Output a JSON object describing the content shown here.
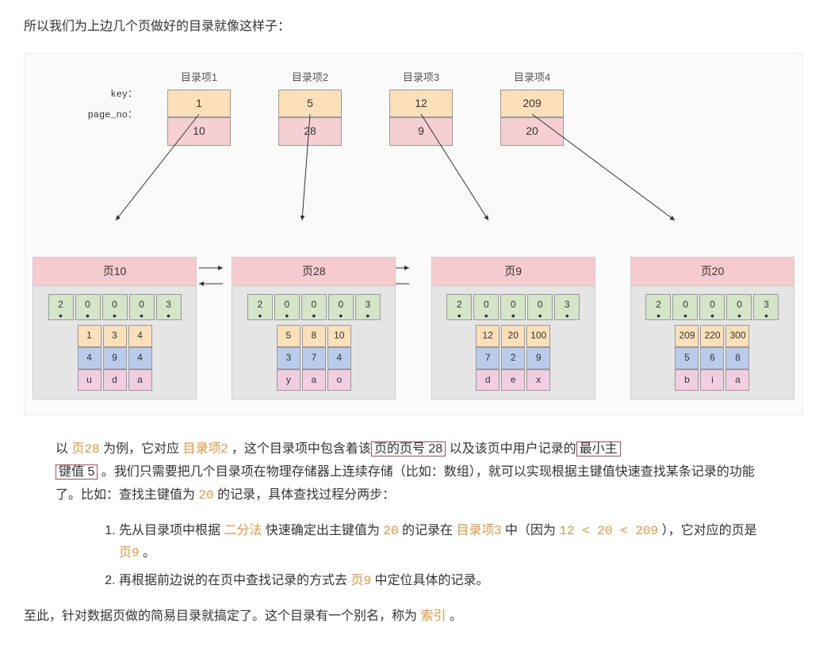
{
  "intro": "所以我们为上边几个页做好的目录就像这样子：",
  "index_labels": {
    "key": "key：",
    "page": "page_no："
  },
  "index_items": [
    {
      "title": "目录项1",
      "key": "1",
      "page": "10"
    },
    {
      "title": "目录项2",
      "key": "5",
      "page": "28"
    },
    {
      "title": "目录项3",
      "key": "12",
      "page": "9"
    },
    {
      "title": "目录项4",
      "key": "209",
      "page": "20"
    }
  ],
  "pages": [
    {
      "title": "页10",
      "slots": [
        "2",
        "0",
        "0",
        "0",
        "3"
      ],
      "recs": [
        {
          "c": [
            "1",
            "4",
            "u"
          ]
        },
        {
          "c": [
            "3",
            "9",
            "d"
          ]
        },
        {
          "c": [
            "4",
            "4",
            "a"
          ]
        }
      ]
    },
    {
      "title": "页28",
      "slots": [
        "2",
        "0",
        "0",
        "0",
        "3"
      ],
      "recs": [
        {
          "c": [
            "5",
            "3",
            "y"
          ]
        },
        {
          "c": [
            "8",
            "7",
            "a"
          ]
        },
        {
          "c": [
            "10",
            "4",
            "o"
          ]
        }
      ]
    },
    {
      "title": "页9",
      "slots": [
        "2",
        "0",
        "0",
        "0",
        "3"
      ],
      "recs": [
        {
          "c": [
            "12",
            "7",
            "d"
          ]
        },
        {
          "c": [
            "20",
            "2",
            "e"
          ]
        },
        {
          "c": [
            "100",
            "9",
            "x"
          ]
        }
      ]
    },
    {
      "title": "页20",
      "slots": [
        "2",
        "0",
        "0",
        "0",
        "3"
      ],
      "recs": [
        {
          "c": [
            "209",
            "5",
            "b"
          ]
        },
        {
          "c": [
            "220",
            "6",
            "i"
          ]
        },
        {
          "c": [
            "300",
            "8",
            "a"
          ]
        }
      ]
    }
  ],
  "para1": {
    "t1": "以 ",
    "page28": "页28",
    "t2": " 为例，它对应 ",
    "idx2": "目录项2",
    "t3": " ，这个目录项中包含着该",
    "box1": "页的页号 28",
    "t4": " 以及该页中用户记录的",
    "box2a": "最小主",
    "box2b": "键值 5",
    "t5": " 。我们只需要把几个目录项在物理存储器上连续存储（比如：数组），就可以实现根据主键值快速查找某条记录的功能了。比如：查找主键值为 ",
    "v20": "20",
    "t6": " 的记录，具体查找过程分两步："
  },
  "step1": {
    "t1": "先从目录项中根据 ",
    "bin": "二分法",
    "t2": " 快速确定出主键值为 ",
    "v20": "20",
    "t3": " 的记录在 ",
    "idx3": "目录项3",
    "t4": " 中（因为 ",
    "expr": "12 < 20 < 209",
    "t5": " ），它对应的页是 ",
    "p9": "页9",
    "t6": " 。"
  },
  "step2": {
    "t1": "再根据前边说的在页中查找记录的方式去 ",
    "p9": "页9",
    "t2": " 中定位具体的记录。"
  },
  "final": {
    "t1": "至此，针对数据页做的简易目录就搞定了。这个目录有一个别名，称为 ",
    "idx": "索引",
    "t2": " 。"
  },
  "chart_data": {
    "type": "diagram",
    "description": "B+-tree-like directory: 4 directory entries each storing (min_key, page_no) pointing down to 4 data pages; pages form a doubly-linked list.",
    "directory_entries": [
      {
        "key": 1,
        "page_no": 10
      },
      {
        "key": 5,
        "page_no": 28
      },
      {
        "key": 12,
        "page_no": 9
      },
      {
        "key": 209,
        "page_no": 20
      }
    ],
    "data_pages": [
      {
        "page_no": 10,
        "header_slots": [
          2,
          0,
          0,
          0,
          3
        ],
        "records": [
          {
            "pk": 1,
            "c2": 4,
            "c3": "u"
          },
          {
            "pk": 3,
            "c2": 9,
            "c3": "d"
          },
          {
            "pk": 4,
            "c2": 4,
            "c3": "a"
          }
        ]
      },
      {
        "page_no": 28,
        "header_slots": [
          2,
          0,
          0,
          0,
          3
        ],
        "records": [
          {
            "pk": 5,
            "c2": 3,
            "c3": "y"
          },
          {
            "pk": 8,
            "c2": 7,
            "c3": "a"
          },
          {
            "pk": 10,
            "c2": 4,
            "c3": "o"
          }
        ]
      },
      {
        "page_no": 9,
        "header_slots": [
          2,
          0,
          0,
          0,
          3
        ],
        "records": [
          {
            "pk": 12,
            "c2": 7,
            "c3": "d"
          },
          {
            "pk": 20,
            "c2": 2,
            "c3": "e"
          },
          {
            "pk": 100,
            "c2": 9,
            "c3": "x"
          }
        ]
      },
      {
        "page_no": 20,
        "header_slots": [
          2,
          0,
          0,
          0,
          3
        ],
        "records": [
          {
            "pk": 209,
            "c2": 5,
            "c3": "b"
          },
          {
            "pk": 220,
            "c2": 6,
            "c3": "i"
          },
          {
            "pk": 300,
            "c2": 8,
            "c3": "a"
          }
        ]
      }
    ],
    "page_link_order": [
      10,
      28,
      9,
      20
    ],
    "link_type": "doubly-linked"
  }
}
